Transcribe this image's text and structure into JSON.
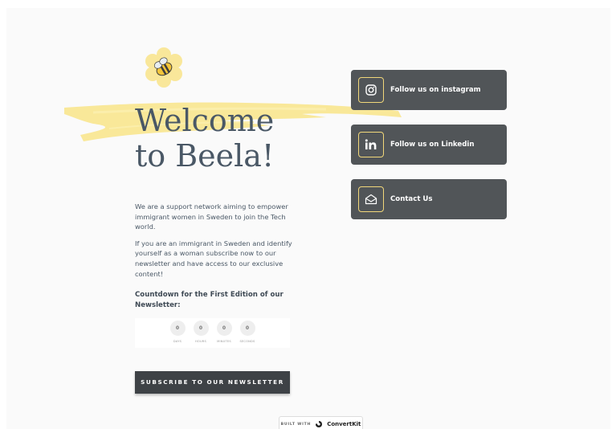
{
  "hero": {
    "title_line1": "Welcome",
    "title_line2": "to Beela!"
  },
  "intro": {
    "paragraph1": "We are a support network aiming to empower immigrant women in Sweden to join the Tech world.",
    "paragraph2": "If you are an immigrant in Sweden and identify yourself as a woman subscribe now to our newsletter and have access to our exclusive content!"
  },
  "countdown": {
    "title": "Countdown for the First Edition of our Newsletter:",
    "units": [
      {
        "value": "0",
        "label": "DAYS"
      },
      {
        "value": "0",
        "label": "HOURS"
      },
      {
        "value": "0",
        "label": "MINUTES"
      },
      {
        "value": "0",
        "label": "SECONDS"
      }
    ]
  },
  "subscribe_label": "SUBSCRIBE TO OUR NEWSLETTER",
  "links": [
    {
      "label": "Follow us on instagram",
      "icon": "instagram-icon"
    },
    {
      "label": "Follow us on Linkedin",
      "icon": "linkedin-icon"
    },
    {
      "label": "Contact Us",
      "icon": "envelope-icon"
    }
  ],
  "footer": {
    "built_with": "BUILT WITH",
    "brand": "ConvertKit"
  },
  "colors": {
    "accent_yellow": "#f1d77a",
    "button_dark": "#515558",
    "title_text": "#4a5866"
  }
}
